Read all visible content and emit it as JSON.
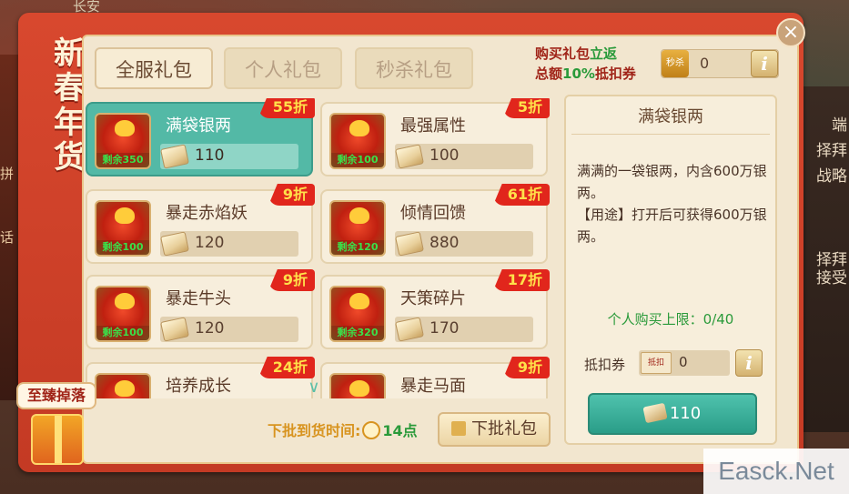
{
  "background": {
    "top_text": "长安",
    "right_texts": [
      "端",
      "择拜",
      "战略",
      "接受",
      "择拜"
    ],
    "left_texts": [
      "拼",
      "话"
    ]
  },
  "side_title": [
    "新",
    "春",
    "年",
    "货"
  ],
  "tabs": [
    {
      "label": "全服礼包",
      "active": true
    },
    {
      "label": "个人礼包",
      "active": false
    },
    {
      "label": "秒杀礼包",
      "active": false
    }
  ],
  "promo": {
    "line1_a": "购买礼包",
    "line1_b": "立返",
    "line2_a": "总额",
    "line2_b": "10%",
    "line2_c": "抵扣券"
  },
  "coupon": {
    "badge": "秒杀",
    "value": "0",
    "info": "i"
  },
  "items": [
    {
      "name": "满袋银两",
      "discount": "55折",
      "remain": "剩余350",
      "price": "110",
      "selected": true
    },
    {
      "name": "最强属性",
      "discount": "5折",
      "remain": "剩余100",
      "price": "100",
      "selected": false
    },
    {
      "name": "暴走赤焰妖",
      "discount": "9折",
      "remain": "剩余100",
      "price": "120",
      "selected": false
    },
    {
      "name": "倾情回馈",
      "discount": "61折",
      "remain": "剩余120",
      "price": "880",
      "selected": false
    },
    {
      "name": "暴走牛头",
      "discount": "9折",
      "remain": "剩余100",
      "price": "120",
      "selected": false
    },
    {
      "name": "天策碎片",
      "discount": "17折",
      "remain": "剩余320",
      "price": "170",
      "selected": false
    },
    {
      "name": "培养成长",
      "discount": "24折",
      "remain": "",
      "price": "",
      "selected": false
    },
    {
      "name": "暴走马面",
      "discount": "9折",
      "remain": "",
      "price": "",
      "selected": false
    }
  ],
  "next_batch": {
    "label": "下批到货时间:",
    "hour": "14点",
    "button": "下批礼包"
  },
  "detail": {
    "title": "满袋银两",
    "desc_1": "满满的一袋银两，内含600万银两。",
    "desc_2": "【用途】打开后可获得600万银两。",
    "limit": "个人购买上限：0/40",
    "deduct_label": "抵扣券",
    "deduct_tag": "抵扣",
    "deduct_value": "0",
    "deduct_info": "i",
    "buy_price": "110"
  },
  "drop_badge": "至臻掉落",
  "close": "×",
  "watermark": "Easck.Net",
  "colors": {
    "frame_red": "#d8482e",
    "panel_cream": "#f2e6cf",
    "selected_teal": "#53b9a6",
    "discount_red": "#e1261c",
    "discount_text": "#ffe14a",
    "remain_green": "#3ae04a",
    "buy_button": "#2a9d88"
  }
}
